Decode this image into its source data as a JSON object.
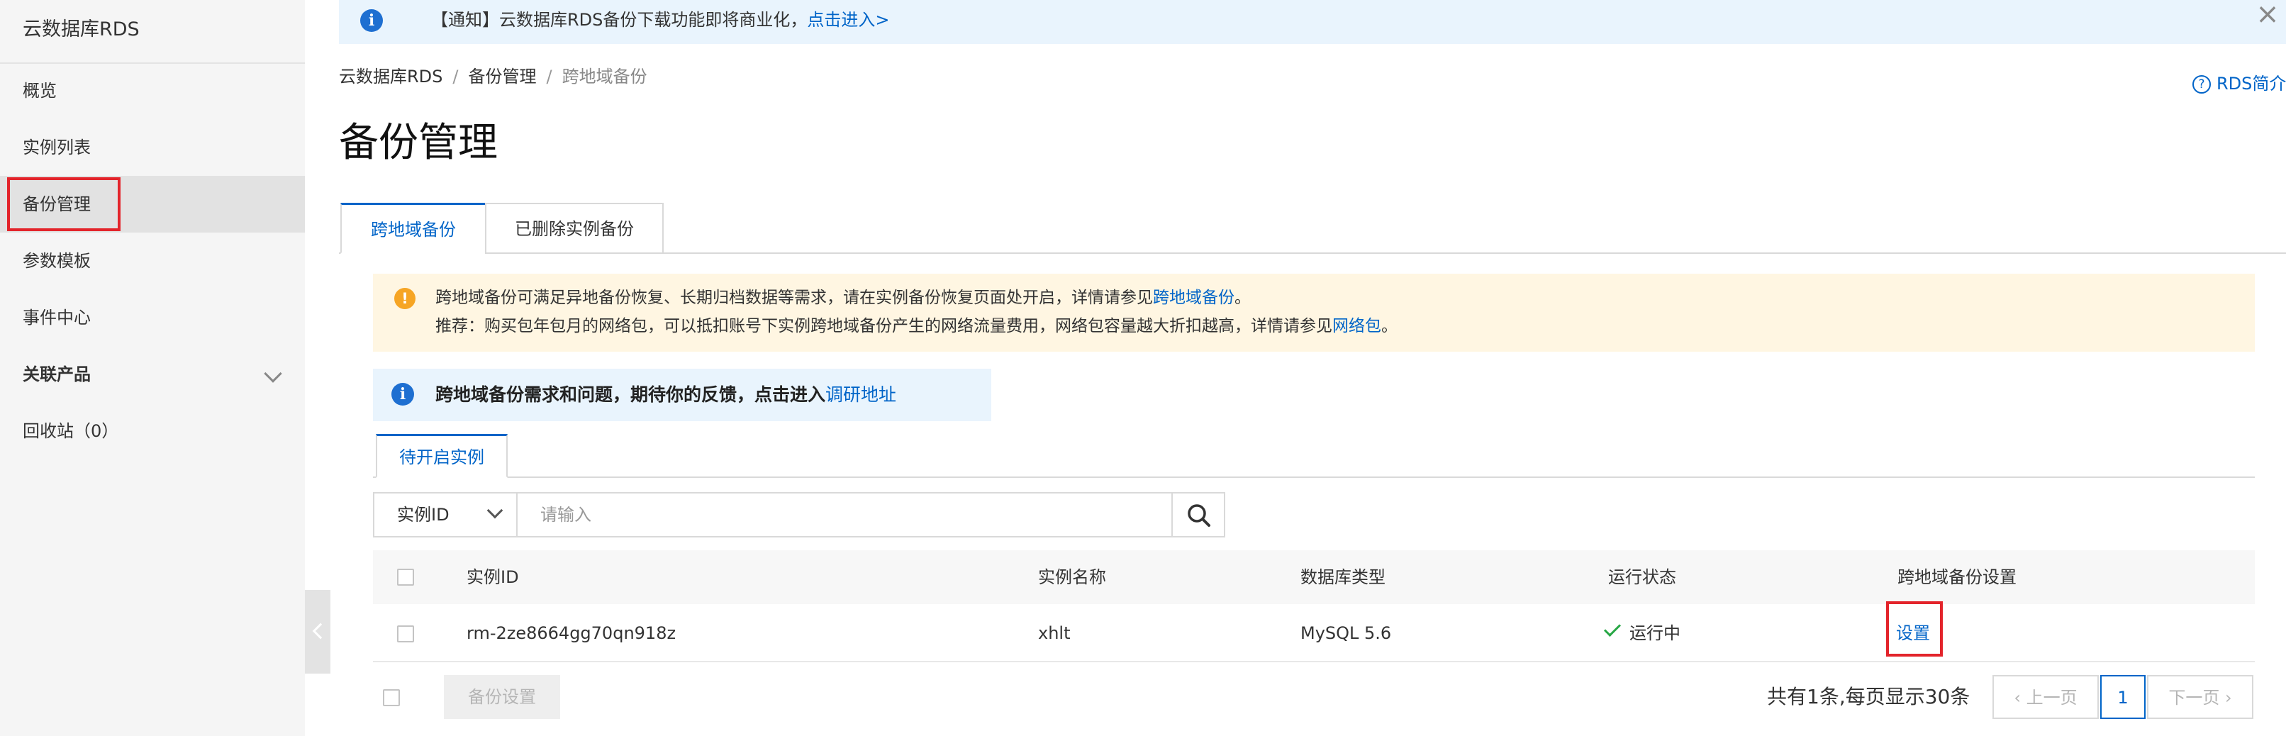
{
  "sidebar": {
    "title": "云数据库RDS",
    "items": [
      {
        "label": "概览"
      },
      {
        "label": "实例列表"
      },
      {
        "label": "备份管理"
      },
      {
        "label": "参数模板"
      },
      {
        "label": "事件中心"
      },
      {
        "label": "关联产品"
      },
      {
        "label": "回收站（0）"
      }
    ]
  },
  "notice": {
    "text": "【通知】云数据库RDS备份下载功能即将商业化，",
    "link": "点击进入>"
  },
  "breadcrumb": {
    "items": [
      "云数据库RDS",
      "备份管理",
      "跨地域备份"
    ],
    "separator": "/"
  },
  "help_link": "RDS简介",
  "page_title": "备份管理",
  "tabs": [
    {
      "label": "跨地域备份"
    },
    {
      "label": "已删除实例备份"
    }
  ],
  "warn": {
    "line1_text": "跨地域备份可满足异地备份恢复、长期归档数据等需求，请在实例备份恢复页面处开启，详情请参见",
    "line1_link": "跨地域备份",
    "line1_end": "。",
    "line2_text": "推荐：购买包年包月的网络包，可以抵扣账号下实例跨地域备份产生的网络流量费用，网络包容量越大折扣越高，详情请参见",
    "line2_link": "网络包",
    "line2_end": "。"
  },
  "feedback": {
    "text": "跨地域备份需求和问题，期待你的反馈，点击进入",
    "link": "调研地址"
  },
  "subtab": "待开启实例",
  "search": {
    "select_value": "实例ID",
    "placeholder": "请输入"
  },
  "table": {
    "columns": [
      "实例ID",
      "实例名称",
      "数据库类型",
      "运行状态",
      "跨地域备份设置"
    ],
    "rows": [
      {
        "id": "rm-2ze8664gg70qn918z",
        "name": "xhlt",
        "db_type": "MySQL 5.6",
        "status": "运行中",
        "action": "设置"
      }
    ]
  },
  "footer": {
    "backup_button": "备份设置",
    "total_text": "共有1条,每页显示30条",
    "prev": "上一页",
    "page": "1",
    "next": "下一页"
  },
  "colors": {
    "accent": "#0064c8",
    "highlight": "#e3242b",
    "success": "#27a745",
    "warning": "#f6a524"
  }
}
